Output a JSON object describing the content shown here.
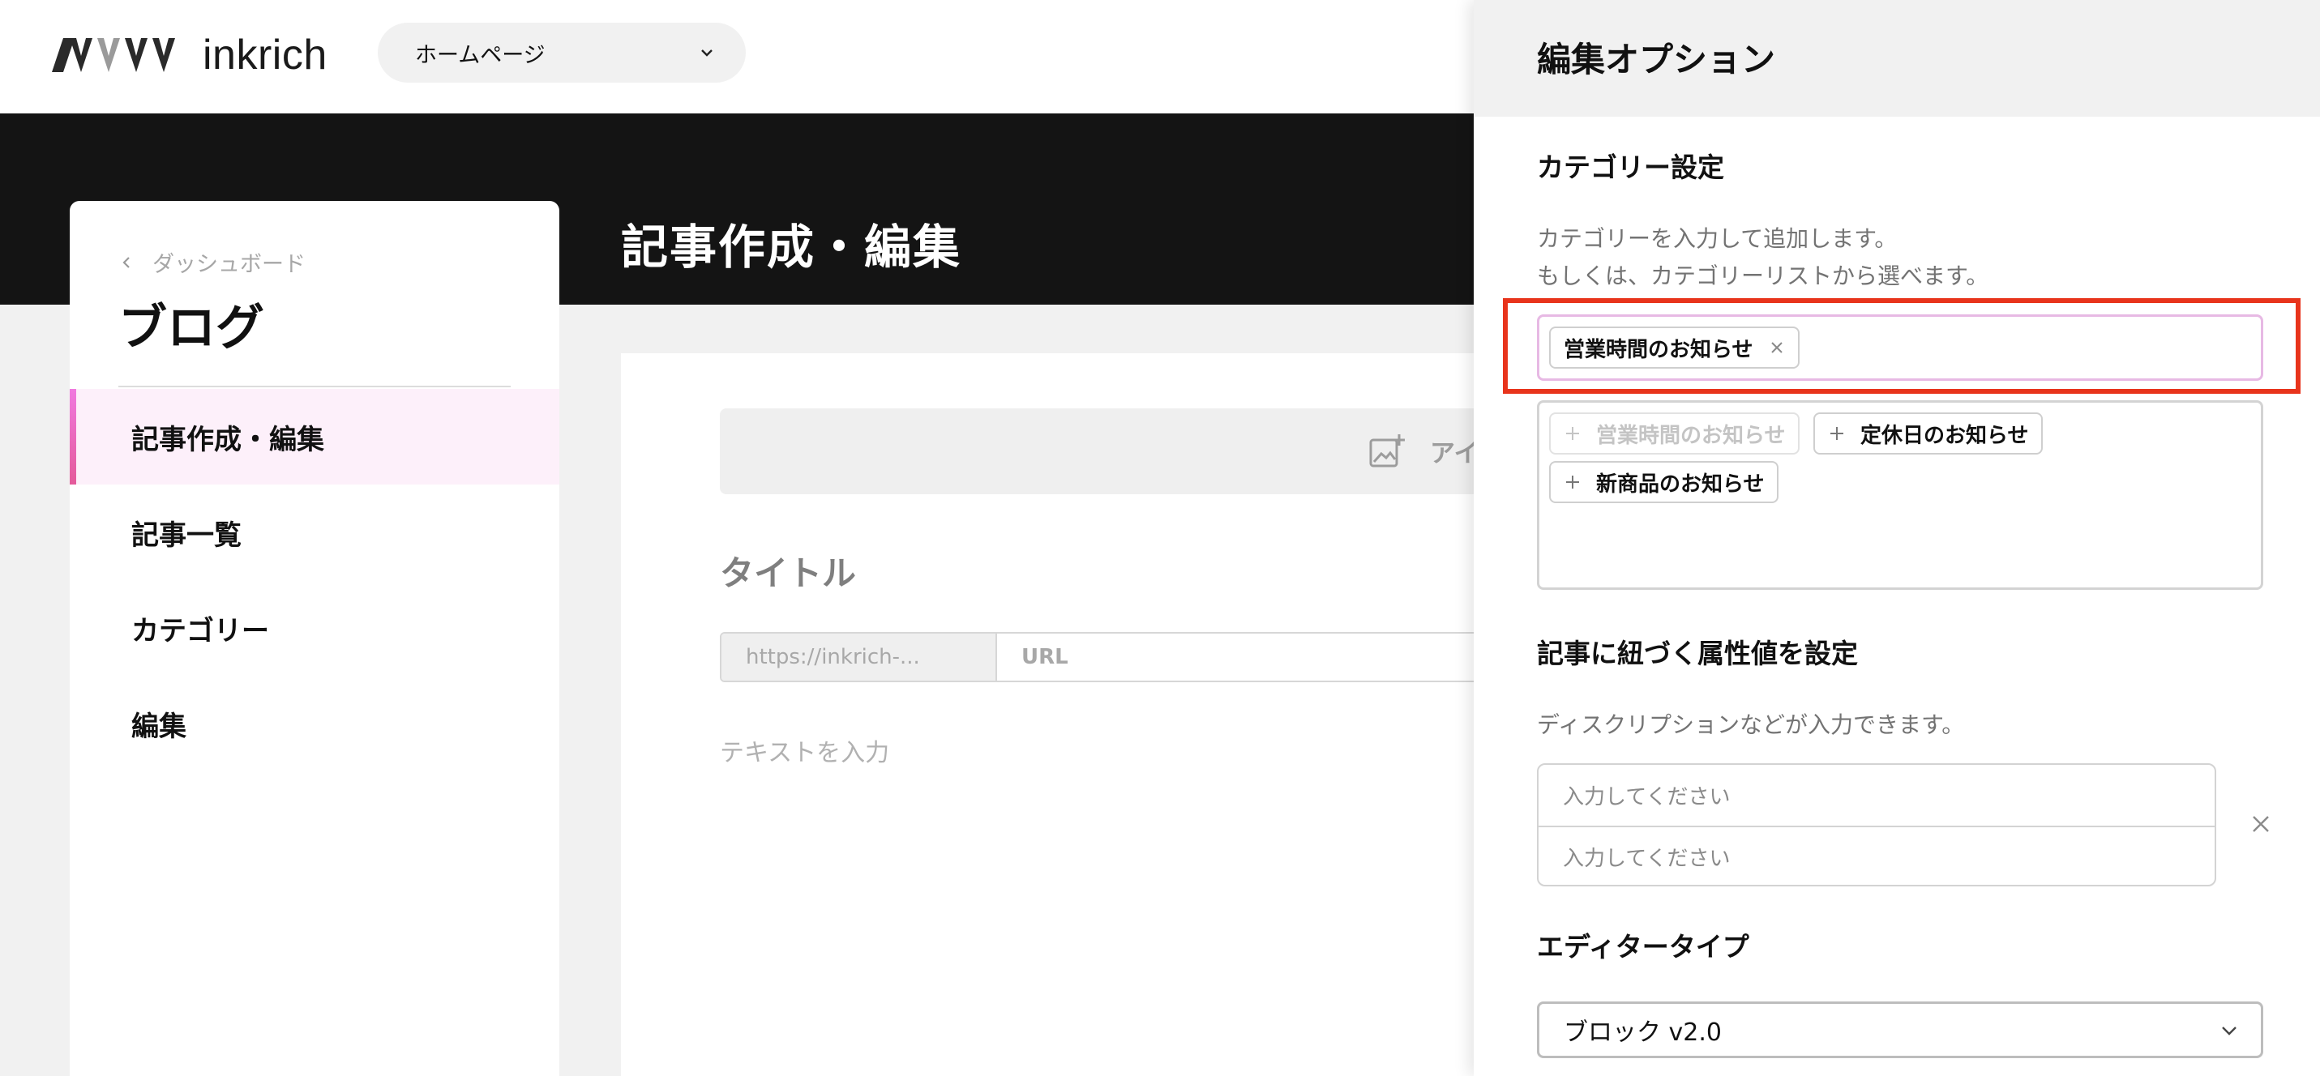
{
  "header": {
    "logo_text": "inkrich",
    "page_select": "ホームページ"
  },
  "page": {
    "heading": "記事作成・編集"
  },
  "sidebar": {
    "back_label": "ダッシュボード",
    "title": "ブログ",
    "items": [
      {
        "label": "記事作成・編集",
        "active": true
      },
      {
        "label": "記事一覧",
        "active": false
      },
      {
        "label": "カテゴリー",
        "active": false
      },
      {
        "label": "編集",
        "active": false
      }
    ]
  },
  "editor": {
    "eyecatch_label": "アイキャッチ",
    "title_placeholder": "タイトル",
    "url_prefix": "https://inkrich-...",
    "url_placeholder": "URL",
    "text_placeholder": "テキストを入力"
  },
  "panel": {
    "title": "編集オプション",
    "category": {
      "title": "カテゴリー設定",
      "desc_line1": "カテゴリーを入力して追加します。",
      "desc_line2": "もしくは、カテゴリーリストから選べます。",
      "selected_tags": [
        "営業時間のお知らせ"
      ],
      "suggestions": [
        {
          "label": "営業時間のお知らせ",
          "disabled": true
        },
        {
          "label": "定休日のお知らせ",
          "disabled": false
        },
        {
          "label": "新商品のお知らせ",
          "disabled": false
        }
      ]
    },
    "attributes": {
      "title": "記事に紐づく属性値を設定",
      "desc": "ディスクリプションなどが入力できます。",
      "key_placeholder": "入力してください",
      "value_placeholder": "入力してください"
    },
    "editor_type": {
      "title": "エディタータイプ",
      "value": "ブロック v2.0"
    }
  },
  "colors": {
    "highlight": "#e8341c",
    "accent": "#e45a9a",
    "active_bg": "#fdf0fa"
  }
}
